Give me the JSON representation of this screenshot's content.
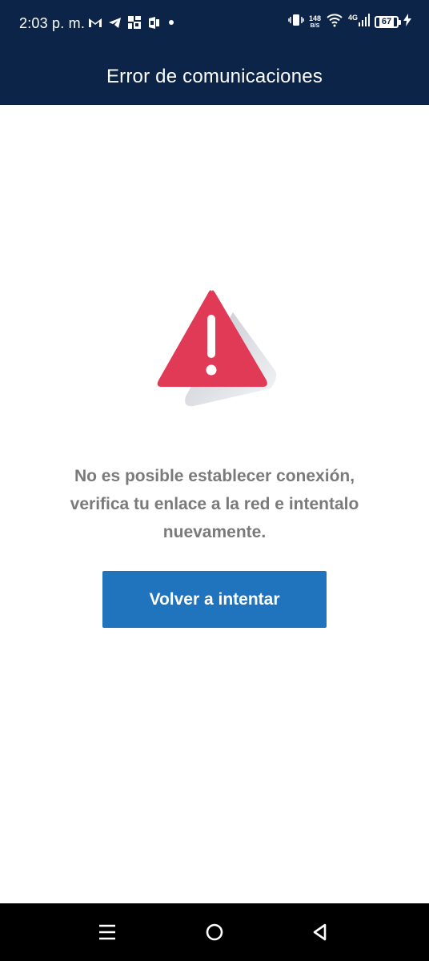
{
  "status_bar": {
    "time": "2:03 p. m.",
    "net_speed_value": "148",
    "net_speed_unit": "B/S",
    "network_type": "4G",
    "battery_level": "67",
    "icons": [
      "gmail-icon",
      "telegram-icon",
      "app-notification-icon",
      "office-icon",
      "dot-icon",
      "vibrate-icon",
      "wifi-icon",
      "signal-icon",
      "battery-icon",
      "charging-icon"
    ]
  },
  "header": {
    "title": "Error de comunicaciones"
  },
  "main": {
    "icon": "warning-triangle-icon",
    "message_line1": "No es posible establecer conexión,",
    "message_line2": "verifica tu enlace a la red e intentalo",
    "message_line3": "nuevamente.",
    "retry_label": "Volver a intentar"
  },
  "colors": {
    "header_background": "#0b2447",
    "warning_red": "#e03a57",
    "button_blue": "#1f74bd",
    "message_gray": "#7a7a7a"
  },
  "nav_bar": {
    "icons": [
      "menu-icon",
      "home-icon",
      "back-icon"
    ]
  }
}
